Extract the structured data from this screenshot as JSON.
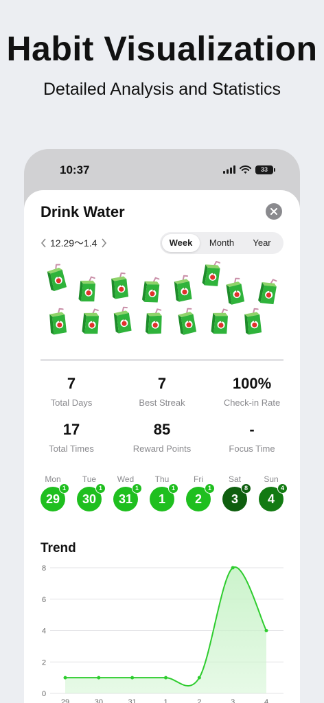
{
  "hero": {
    "title": "Habit Visualization",
    "subtitle": "Detailed Analysis and Statistics"
  },
  "status_bar": {
    "time": "10:37",
    "battery": "33"
  },
  "habit": {
    "title": "Drink Water",
    "date_range": "12.29～1.4",
    "tabs": [
      {
        "label": "Week",
        "active": true
      },
      {
        "label": "Month",
        "active": false
      },
      {
        "label": "Year",
        "active": false
      }
    ],
    "check_in_count": 17,
    "icon": "apple-juice-box-icon"
  },
  "stats": [
    {
      "value": "7",
      "label": "Total Days"
    },
    {
      "value": "7",
      "label": "Best Streak"
    },
    {
      "value": "100%",
      "label": "Check-in Rate"
    },
    {
      "value": "17",
      "label": "Total Times"
    },
    {
      "value": "85",
      "label": "Reward Points"
    },
    {
      "value": "-",
      "label": "Focus Time"
    }
  ],
  "days": [
    {
      "name": "Mon",
      "date": "29",
      "count": "1"
    },
    {
      "name": "Tue",
      "date": "30",
      "count": "1"
    },
    {
      "name": "Wed",
      "date": "31",
      "count": "1"
    },
    {
      "name": "Thu",
      "date": "1",
      "count": "1"
    },
    {
      "name": "Fri",
      "date": "2",
      "count": "1"
    },
    {
      "name": "Sat",
      "date": "3",
      "count": "8"
    },
    {
      "name": "Sun",
      "date": "4",
      "count": "4"
    }
  ],
  "colors": {
    "light_green": "#1fbf1f",
    "dark_green": "#0f5e0f",
    "mid_green": "#127a12",
    "line_green": "#2ecc2e",
    "fill_green": "#c9f3c9"
  },
  "trend": {
    "title": "Trend",
    "chart_data": {
      "type": "area",
      "x": [
        "29",
        "30",
        "31",
        "1",
        "2",
        "3",
        "4"
      ],
      "values": [
        1,
        1,
        1,
        1,
        1,
        8,
        4
      ],
      "ylim": [
        0,
        8
      ],
      "yticks": [
        0,
        2,
        4,
        6,
        8
      ],
      "grid": true
    }
  }
}
